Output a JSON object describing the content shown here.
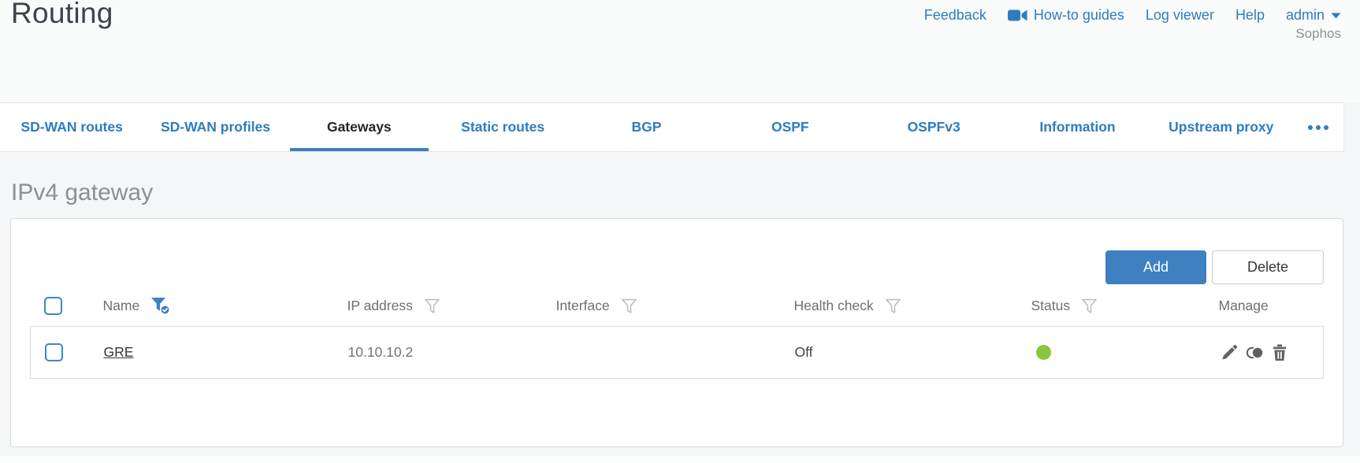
{
  "app": {
    "page_title": "Routing",
    "brand": "Sophos"
  },
  "header_links": {
    "feedback": "Feedback",
    "howto_guides": "How-to guides",
    "log_viewer": "Log viewer",
    "help": "Help",
    "user": "admin"
  },
  "tabs": {
    "items": [
      {
        "label": "SD-WAN routes",
        "active": false
      },
      {
        "label": "SD-WAN profiles",
        "active": false
      },
      {
        "label": "Gateways",
        "active": true
      },
      {
        "label": "Static routes",
        "active": false
      },
      {
        "label": "BGP",
        "active": false
      },
      {
        "label": "OSPF",
        "active": false
      },
      {
        "label": "OSPFv3",
        "active": false
      },
      {
        "label": "Information",
        "active": false
      },
      {
        "label": "Upstream proxy",
        "active": false
      }
    ],
    "more_icon": "ellipsis"
  },
  "section": {
    "heading": "IPv4 gateway"
  },
  "toolbar": {
    "add": "Add",
    "delete": "Delete"
  },
  "table": {
    "columns": {
      "name": "Name",
      "ip": "IP address",
      "interface": "Interface",
      "health": "Health check",
      "status": "Status",
      "manage": "Manage"
    },
    "filters": {
      "name": "active",
      "ip": "default",
      "interface": "default",
      "health": "default",
      "status": "default"
    },
    "rows": [
      {
        "name": "GRE",
        "ip": "10.10.10.2",
        "interface": "",
        "health": "Off",
        "status": "green",
        "manage": [
          "edit",
          "clone",
          "delete"
        ]
      }
    ]
  },
  "colors": {
    "accent_blue": "#2e7cc0",
    "button_blue": "#3f80c0",
    "status_green": "#8bc53f",
    "active_filter_blue": "#3c82c5"
  }
}
